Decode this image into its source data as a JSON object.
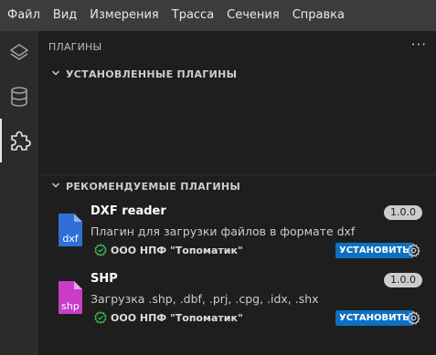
{
  "menu": [
    "Файл",
    "Вид",
    "Измерения",
    "Трасса",
    "Сечения",
    "Справка"
  ],
  "activity_bar": [
    {
      "icon": "layers-icon",
      "active": false
    },
    {
      "icon": "database-icon",
      "active": false
    },
    {
      "icon": "puzzle-icon",
      "active": true
    }
  ],
  "panel": {
    "title": "ПЛАГИНЫ",
    "more": "···",
    "installed_section": "УСТАНОВЛЕННЫЕ ПЛАГИНЫ",
    "recommended_section": "РЕКОМЕНДУЕМЫЕ ПЛАГИНЫ"
  },
  "plugins": [
    {
      "name": "DXF reader",
      "description": "Плагин для загрузки файлов в формате dxf",
      "publisher": "ООО НПФ \"Топоматик\"",
      "version": "1.0.0",
      "install_label": "УСТАНОВИТЬ",
      "icon_label": "dxf",
      "icon_color": "#2f6fd6"
    },
    {
      "name": "SHP",
      "description": "Загрузка .shp, .dbf, .prj, .cpg, .idx, .shx",
      "publisher": "ООО НПФ \"Топоматик\"",
      "version": "1.0.0",
      "install_label": "УСТАНОВИТЬ",
      "icon_label": "shp",
      "icon_color": "#c83cc8"
    }
  ],
  "colors": {
    "accent": "#0e70c0",
    "verified": "#3fb950"
  }
}
